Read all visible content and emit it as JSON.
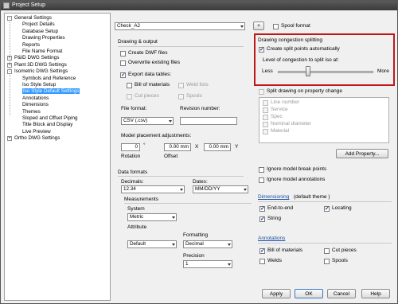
{
  "window": {
    "title": "Project Setup"
  },
  "tree": {
    "items": [
      {
        "label": "General Settings",
        "level": 0,
        "exp": "-"
      },
      {
        "label": "Project Details",
        "level": 1
      },
      {
        "label": "Database Setup",
        "level": 1
      },
      {
        "label": "Drawing Properties",
        "level": 1
      },
      {
        "label": "Reports",
        "level": 1
      },
      {
        "label": "File Name Format",
        "level": 1
      },
      {
        "label": "P&ID DWG Settings",
        "level": 0,
        "exp": "+"
      },
      {
        "label": "Plant 3D DWG Settings",
        "level": 0,
        "exp": "+"
      },
      {
        "label": "Isometric DWG Settings",
        "level": 0,
        "exp": "-"
      },
      {
        "label": "Symbols and Reference",
        "level": 1
      },
      {
        "label": "Iso Style Setup",
        "level": 1
      },
      {
        "label": "Iso Style Default Settings",
        "level": 1,
        "selected": true
      },
      {
        "label": "Annotations",
        "level": 1
      },
      {
        "label": "Dimensions",
        "level": 1
      },
      {
        "label": "Themes",
        "level": 1
      },
      {
        "label": "Sloped and Offset Piping",
        "level": 1
      },
      {
        "label": "Title Block and Display",
        "level": 1
      },
      {
        "label": "Live Preview",
        "level": 1
      },
      {
        "label": "Ortho DWG Settings",
        "level": 0,
        "exp": "+"
      }
    ]
  },
  "top": {
    "style_value": "Check_A2",
    "plus_label": "+",
    "spool_format_label": "Spool format"
  },
  "drawing_output": {
    "header": "Drawing & output",
    "create_dwf": "Create DWF files",
    "overwrite": "Overwrite existing files",
    "export_tables": "Export data tables:",
    "bom": "Bill of materials",
    "weld_lists": "Weld lists",
    "cut_pieces": "Cut pieces",
    "spools": "Spools",
    "file_format_label": "File format:",
    "file_format_value": "CSV (.csv)",
    "revision_label": "Revision number:",
    "revision_value": "",
    "placement_label": "Model placement adjustments:",
    "rotation_value": "0",
    "rotation_unit": "°",
    "offset_x_value": "0.00 mm",
    "x_label": "X",
    "offset_y_value": "0.00 mm",
    "y_label": "Y",
    "rotation_label": "Rotation",
    "offset_label": "Offset"
  },
  "data_formats": {
    "header": "Data formats",
    "decimals_label": "Decimals:",
    "decimals_value": "12.34",
    "dates_label": "Dates:",
    "dates_value": "MM/DD/YY",
    "measurements_label": "Measurements",
    "system_label": "System",
    "system_value": "Metric",
    "attribute_label": "Attribute",
    "attribute_value": "Default",
    "formatting_label": "Formatting",
    "formatting_value": "Decimal",
    "precision_label": "Precision",
    "precision_value": "1"
  },
  "congestion": {
    "header": "Drawing congestion splitting",
    "auto_split": "Create split points automatically",
    "level_label": "Level of congestion to split iso at:",
    "less": "Less",
    "more": "More",
    "level": 0.32
  },
  "split_property": {
    "label": "Split drawing on property change",
    "items": [
      "Line number",
      "Service",
      "Spec",
      "Nominal diameter",
      "Material"
    ],
    "add_property": "Add Property..."
  },
  "ignore": {
    "break_points": "Ignore model break points",
    "annotations": "Ignore model annotations"
  },
  "dimensioning": {
    "link": "Dimensioning",
    "theme": "(default theme )",
    "end_to_end": "End-to-end",
    "locating": "Locating",
    "string": "String"
  },
  "annotations": {
    "link": "Annotations",
    "bom": "Bill of materials",
    "cut_pieces": "Cut pieces",
    "welds": "Welds",
    "spools": "Spools"
  },
  "buttons": {
    "apply": "Apply",
    "ok": "OK",
    "cancel": "Cancel",
    "help": "Help"
  }
}
